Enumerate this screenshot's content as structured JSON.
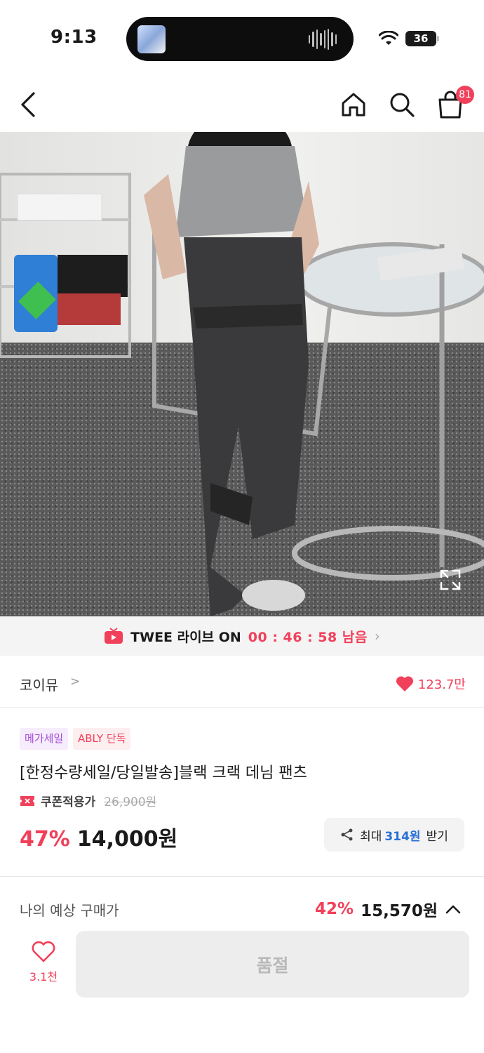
{
  "status_bar": {
    "time": "9:13",
    "battery": "36"
  },
  "nav": {
    "cart_count": "81"
  },
  "live": {
    "title": "TWEE 라이브 ON",
    "timer": "00 : 46 : 58 남음"
  },
  "shop": {
    "name": "코이뮤",
    "likes": "123.7만"
  },
  "tags": [
    "메가세일",
    "ABLY 단독"
  ],
  "product": {
    "title": "[한정수량세일/당일발송]블랙 크랙 데님 팬츠",
    "coupon_label": "쿠폰적용가",
    "original_price": "26,900원",
    "discount": "47%",
    "price": "14,000원"
  },
  "coupon_button": {
    "prefix": "최대",
    "amount": "314원",
    "suffix": "받기"
  },
  "expected": {
    "label": "나의 예상 구매가",
    "discount": "42%",
    "price": "15,570원"
  },
  "bottom": {
    "wish_count": "3.1천",
    "soldout_label": "품절"
  },
  "colors": {
    "accent": "#f1405a",
    "coupon_blue": "#2a6fd6",
    "mega_purple": "#a24fd6"
  }
}
